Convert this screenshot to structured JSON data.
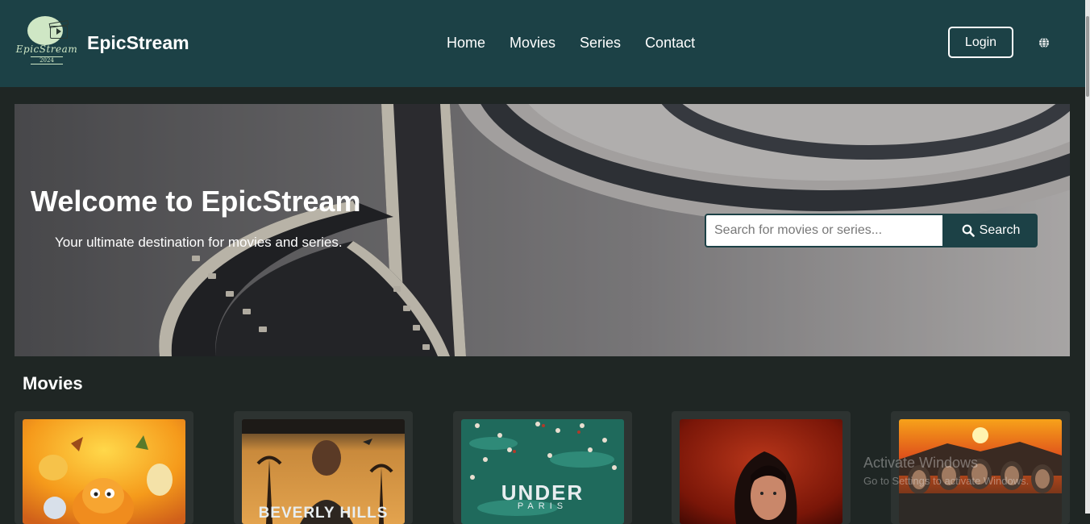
{
  "navbar": {
    "logo_text": "EpicStream",
    "logo_year": "2024",
    "brand": "EpicStream",
    "links": [
      "Home",
      "Movies",
      "Series",
      "Contact"
    ],
    "login_label": "Login",
    "bg_color": "#1c4146"
  },
  "hero": {
    "title": "Welcome to EpicStream",
    "subtitle": "Your ultimate destination for movies and series.",
    "search_placeholder": "Search for movies or series...",
    "search_button": "Search"
  },
  "movies": {
    "section_title": "Movies",
    "posters": [
      {
        "id": "poster-1",
        "text": ""
      },
      {
        "id": "poster-2",
        "text": "BEVERLY HILLS"
      },
      {
        "id": "poster-3",
        "text": "UNDER",
        "sub": "PARIS"
      },
      {
        "id": "poster-4",
        "text": ""
      },
      {
        "id": "poster-5",
        "text": ""
      }
    ]
  },
  "os_watermark": {
    "line1": "Activate Windows",
    "line2": "Go to Settings to activate Windows."
  },
  "colors": {
    "accent": "#1c4146",
    "page_bg": "#1f2624",
    "card_bg": "#2d3331"
  }
}
